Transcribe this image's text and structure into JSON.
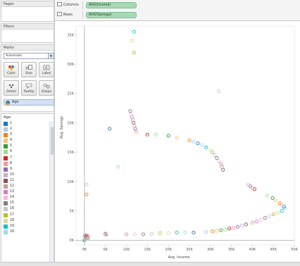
{
  "cards": {
    "pages": {
      "title": "Pages"
    },
    "filters": {
      "title": "Filters"
    },
    "marks": {
      "title": "Marks",
      "type_value": "Automatic",
      "buttons": [
        "Color",
        "Size",
        "Label",
        "Detail",
        "Tooltip",
        "Shape"
      ],
      "field_pill": "Age"
    }
  },
  "shelves": {
    "columns": {
      "label": "Columns",
      "pill": "AVG(Income)"
    },
    "rows": {
      "label": "Rows",
      "pill": "AVG(Savings)"
    }
  },
  "legend": {
    "title": "Age",
    "items": [
      {
        "label": "1",
        "color": "#1f77b4"
      },
      {
        "label": "2",
        "color": "#aec7e8"
      },
      {
        "label": "3",
        "color": "#ff7f0e"
      },
      {
        "label": "4",
        "color": "#ffbb78"
      },
      {
        "label": "5",
        "color": "#2ca02c"
      },
      {
        "label": "6",
        "color": "#98df8a"
      },
      {
        "label": "7",
        "color": "#d62728"
      },
      {
        "label": "8",
        "color": "#ff9896"
      },
      {
        "label": "9",
        "color": "#9467bd"
      },
      {
        "label": "10",
        "color": "#c5b0d5"
      },
      {
        "label": "11",
        "color": "#8c564b"
      },
      {
        "label": "12",
        "color": "#c49c94"
      },
      {
        "label": "13",
        "color": "#e377c2"
      },
      {
        "label": "14",
        "color": "#f7b6d2"
      },
      {
        "label": "15",
        "color": "#7f7f7f"
      },
      {
        "label": "16",
        "color": "#c7c7c7"
      },
      {
        "label": "17",
        "color": "#bcbd22"
      },
      {
        "label": "18",
        "color": "#dbdb8d"
      },
      {
        "label": "19",
        "color": "#17becf"
      },
      {
        "label": "20",
        "color": "#9edae5"
      }
    ]
  },
  "chart_data": {
    "type": "scatter",
    "xlabel": "Avg. Income",
    "ylabel": "Avg. Savings",
    "xlim": [
      -2000,
      50000
    ],
    "ylim": [
      -800,
      36500
    ],
    "x_ticks": [
      "0K",
      "5K",
      "10K",
      "15K",
      "20K",
      "25K",
      "30K",
      "35K",
      "40K",
      "45K",
      "50K"
    ],
    "x_tick_values": [
      0,
      5000,
      10000,
      15000,
      20000,
      25000,
      30000,
      35000,
      40000,
      45000,
      50000
    ],
    "y_ticks": [
      "0K",
      "5K",
      "10K",
      "15K",
      "20K",
      "25K",
      "30K",
      "35K"
    ],
    "y_tick_values": [
      0,
      5000,
      10000,
      15000,
      20000,
      25000,
      30000,
      35000
    ],
    "marker": "hollow-circle",
    "palette": [
      "#1f77b4",
      "#aec7e8",
      "#ff7f0e",
      "#ffbb78",
      "#2ca02c",
      "#98df8a",
      "#d62728",
      "#ff9896",
      "#9467bd",
      "#c5b0d5",
      "#8c564b",
      "#c49c94",
      "#e377c2",
      "#f7b6d2",
      "#7f7f7f",
      "#c7c7c7",
      "#bcbd22",
      "#dbdb8d",
      "#17becf",
      "#9edae5"
    ],
    "points": [
      [
        0,
        0
      ],
      [
        200,
        300
      ],
      [
        400,
        600
      ],
      [
        600,
        900
      ],
      [
        800,
        500
      ],
      [
        300,
        200
      ],
      [
        500,
        700
      ],
      [
        700,
        400
      ],
      [
        100,
        800
      ],
      [
        900,
        300
      ],
      [
        5000,
        1100
      ],
      [
        5200,
        900
      ],
      [
        10000,
        1000
      ],
      [
        12000,
        1000
      ],
      [
        14000,
        1000
      ],
      [
        16000,
        1100
      ],
      [
        18000,
        1200
      ],
      [
        20000,
        1200
      ],
      [
        22000,
        1300
      ],
      [
        24000,
        1300
      ],
      [
        26000,
        1300
      ],
      [
        29000,
        1400
      ],
      [
        30500,
        1500
      ],
      [
        31500,
        1600
      ],
      [
        32500,
        1700
      ],
      [
        33500,
        1800
      ],
      [
        34500,
        2000
      ],
      [
        35500,
        2100
      ],
      [
        36500,
        2300
      ],
      [
        37500,
        2500
      ],
      [
        38500,
        2700
      ],
      [
        40000,
        3000
      ],
      [
        41000,
        3200
      ],
      [
        42000,
        3500
      ],
      [
        43000,
        3800
      ],
      [
        44000,
        4100
      ],
      [
        45000,
        4400
      ],
      [
        46000,
        4700
      ],
      [
        47000,
        5000
      ],
      [
        47800,
        5400
      ],
      [
        47500,
        5700
      ],
      [
        47000,
        6000
      ],
      [
        46500,
        6300
      ],
      [
        45500,
        6800
      ],
      [
        44800,
        7200
      ],
      [
        43500,
        7600
      ],
      [
        40500,
        8700
      ],
      [
        40000,
        8900
      ],
      [
        39500,
        9200
      ],
      [
        39000,
        9400
      ],
      [
        33000,
        12000
      ],
      [
        32800,
        12500
      ],
      [
        32500,
        13000
      ],
      [
        32000,
        13500
      ],
      [
        31500,
        14000
      ],
      [
        31000,
        14500
      ],
      [
        30500,
        15000
      ],
      [
        30000,
        15400
      ],
      [
        29000,
        15800
      ],
      [
        28000,
        16200
      ],
      [
        27000,
        16500
      ],
      [
        26000,
        16800
      ],
      [
        25000,
        17000
      ],
      [
        22000,
        17500
      ],
      [
        20000,
        17800
      ],
      [
        17000,
        18000
      ],
      [
        15000,
        18000
      ],
      [
        12300,
        18500
      ],
      [
        12100,
        19000
      ],
      [
        11900,
        19500
      ],
      [
        11700,
        20000
      ],
      [
        11500,
        20500
      ],
      [
        11300,
        21000
      ],
      [
        11100,
        21500
      ],
      [
        10900,
        22000
      ],
      [
        32000,
        25400
      ],
      [
        11800,
        32000
      ],
      [
        11300,
        34000
      ],
      [
        11800,
        35500
      ],
      [
        8000,
        12500
      ],
      [
        6000,
        19000
      ],
      [
        500,
        9500
      ],
      [
        500,
        7800
      ]
    ]
  }
}
